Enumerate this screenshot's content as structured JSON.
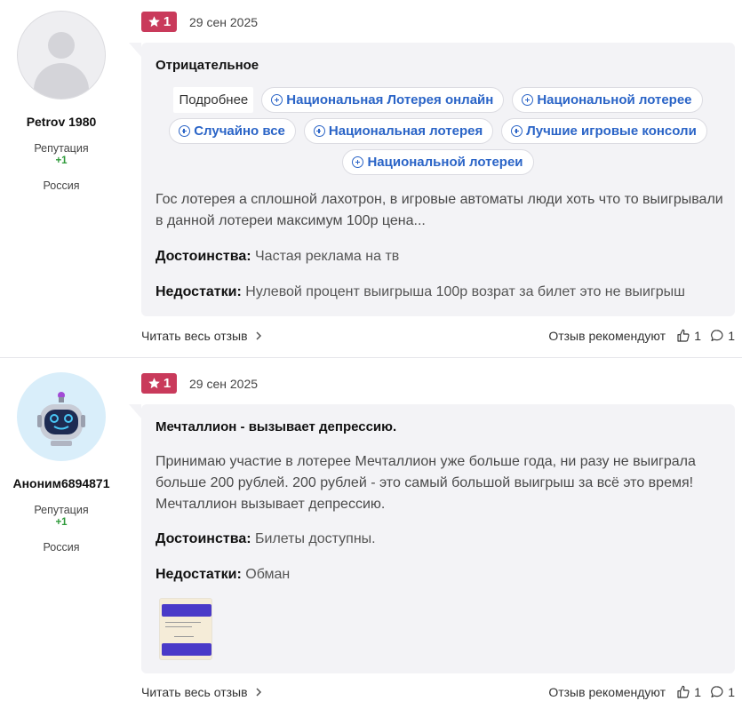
{
  "reviews": [
    {
      "author": {
        "name": "Petrov 1980",
        "reputation_label": "Репутация",
        "reputation_value": "+1",
        "country": "Россия",
        "avatar": "default-user-icon"
      },
      "rating": "1",
      "date": "29 сен 2025",
      "title": "Отрицательное",
      "tags_more": "Подробнее",
      "tags": [
        "Национальная Лотерея онлайн",
        "Национальной лотерее",
        "Случайно все",
        "Национальная лотерея",
        "Лучшие игровые консоли",
        "Национальной лотереи"
      ],
      "text": "Гос лотерея а сплошной лахотрон, в игровые автоматы люди хоть что то выигрывали в данной лотереи максимум 100р цена...",
      "pros_label": "Достоинства:",
      "pros": "Частая реклама на тв",
      "cons_label": "Недостатки:",
      "cons": "Нулевой процент выигрыша 100р возрат за билет это не выигрыш",
      "read_more": "Читать весь отзыв",
      "recommend": "Отзыв рекомендуют",
      "likes": "1",
      "comments": "1"
    },
    {
      "author": {
        "name": "Аноним6894871",
        "reputation_label": "Репутация",
        "reputation_value": "+1",
        "country": "Россия",
        "avatar": "robot-avatar-icon"
      },
      "rating": "1",
      "date": "29 сен 2025",
      "title": "Мечталлион - вызывает депрессию.",
      "text": "Принимаю участие в лотерее Мечталлион уже больше года, ни разу не выиграла больше 200 рублей. 200 рублей - это самый большой выигрыш за всё это время! Мечталлион вызывает депрессию.",
      "pros_label": "Достоинства:",
      "pros": "Билеты доступны.",
      "cons_label": "Недостатки:",
      "cons": "Обман",
      "read_more": "Читать весь отзыв",
      "recommend": "Отзыв рекомендуют",
      "likes": "1",
      "comments": "1"
    }
  ],
  "colors": {
    "rating_badge": "#c93a5b",
    "tag_text": "#2a64c7",
    "reputation": "#2e9a3a",
    "card_bg": "#f3f3f6"
  }
}
